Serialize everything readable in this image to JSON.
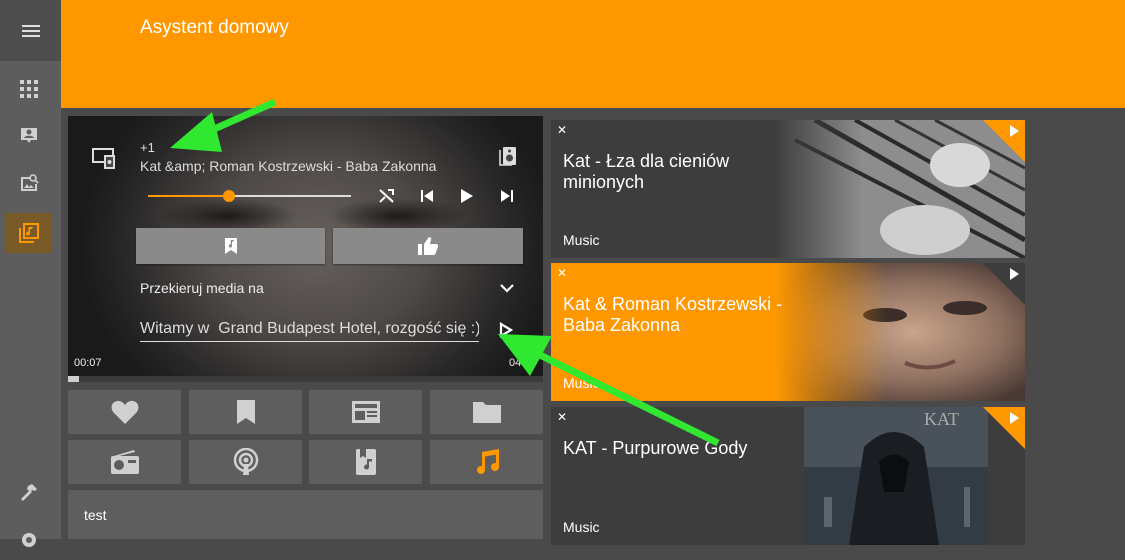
{
  "app": {
    "title": "Asystent domowy"
  },
  "sidebar": {
    "items": [
      {
        "icon": "menu-icon"
      },
      {
        "icon": "grid-icon"
      },
      {
        "icon": "account-box-icon"
      },
      {
        "icon": "image-search-icon"
      },
      {
        "icon": "music-box-icon",
        "active": true
      },
      {
        "icon": "hammer-icon"
      },
      {
        "icon": "settings-icon"
      }
    ],
    "accent": "#ff9800"
  },
  "player": {
    "title": "+1",
    "artist": "Kat &amp; Roman Kostrzewski - Baba Zakonna",
    "seek_fraction": 0.4,
    "redirect_label": "Przekieruj media na",
    "tts_input_value": "Witamy w  Grand Budapest Hotel, rozgość się :)",
    "time_elapsed": "00:07",
    "time_total": "04:",
    "progress_fraction": 0.023
  },
  "tiles": [
    {
      "icon": "heart-icon"
    },
    {
      "icon": "bookmark-icon"
    },
    {
      "icon": "newspaper-icon"
    },
    {
      "icon": "folder-icon"
    },
    {
      "icon": "radio-icon"
    },
    {
      "icon": "podcast-icon"
    },
    {
      "icon": "book-music-icon"
    },
    {
      "icon": "music-note-icon",
      "active": true
    }
  ],
  "text_card": {
    "label": "test"
  },
  "queue": [
    {
      "title": "Kat - Łza dla cieniów minionych",
      "subtitle": "Music",
      "active": false
    },
    {
      "title": "Kat & Roman Kostrzewski - Baba Zakonna",
      "subtitle": "Music",
      "active": true
    },
    {
      "title": "KAT - Purpurowe Gody",
      "subtitle": "Music",
      "active": false
    }
  ],
  "colors": {
    "header": "#ff9800",
    "annotation_arrow": "#2fe82f"
  }
}
